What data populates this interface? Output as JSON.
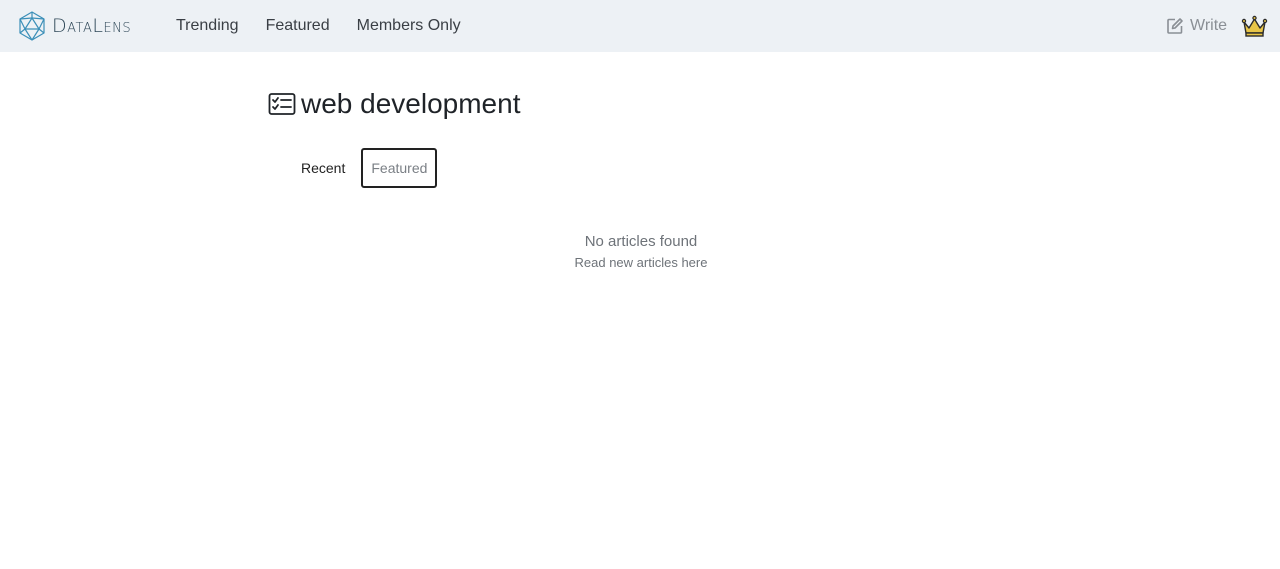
{
  "brand": {
    "name": "DataLens"
  },
  "nav": {
    "items": [
      {
        "label": "Trending"
      },
      {
        "label": "Featured"
      },
      {
        "label": "Members Only"
      }
    ],
    "write_label": "Write"
  },
  "page": {
    "title": "web development",
    "tabs": [
      {
        "label": "Recent"
      },
      {
        "label": "Featured"
      }
    ],
    "empty_title": "No articles found",
    "empty_link": "Read new articles here"
  },
  "colors": {
    "navbar_bg": "#edf1f5",
    "brand_icon": "#3b8fb8",
    "crown": "#e8c547"
  }
}
